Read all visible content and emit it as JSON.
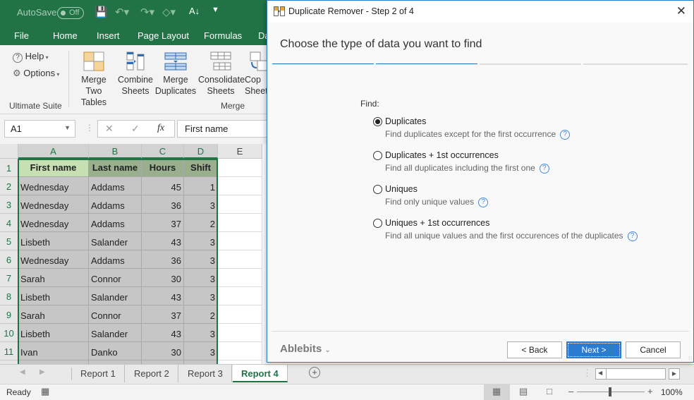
{
  "excel": {
    "titlebar": {
      "autosave_label": "AutoSave",
      "autosave_state": "Off",
      "icons": [
        "save-icon",
        "undo-icon",
        "redo-icon",
        "shape-icon",
        "sort-az-icon",
        "customize-icon"
      ]
    },
    "menu": [
      "File",
      "Home",
      "Insert",
      "Page Layout",
      "Formulas",
      "Da"
    ],
    "ribbon": {
      "help_label": "Help",
      "options_label": "Options",
      "group1_label": "Ultimate Suite",
      "buttons": [
        {
          "line1": "Merge",
          "line2": "Two Tables"
        },
        {
          "line1": "Combine",
          "line2": "Sheets"
        },
        {
          "line1": "Merge",
          "line2": "Duplicates"
        },
        {
          "line1": "Consolidate",
          "line2": "Sheets"
        },
        {
          "line1": "Cop",
          "line2": "Sheet"
        }
      ],
      "group2_label": "Merge"
    },
    "formula_bar": {
      "name_box": "A1",
      "fx_label": "fx",
      "value": "First name"
    },
    "columns": [
      "A",
      "B",
      "C",
      "D",
      "E"
    ],
    "rows": [
      "1",
      "2",
      "3",
      "4",
      "5",
      "6",
      "7",
      "8",
      "9",
      "10",
      "11"
    ],
    "table": {
      "headers": [
        "First name",
        "Last name",
        "Hours",
        "Shift"
      ],
      "rows": [
        [
          "Wednesday",
          "Addams",
          "45",
          "1"
        ],
        [
          "Wednesday",
          "Addams",
          "36",
          "3"
        ],
        [
          "Wednesday",
          "Addams",
          "37",
          "2"
        ],
        [
          "Lisbeth",
          "Salander",
          "43",
          "3"
        ],
        [
          "Wednesday",
          "Addams",
          "36",
          "3"
        ],
        [
          "Sarah",
          "Connor",
          "30",
          "3"
        ],
        [
          "Lisbeth",
          "Salander",
          "43",
          "3"
        ],
        [
          "Sarah",
          "Connor",
          "37",
          "2"
        ],
        [
          "Lisbeth",
          "Salander",
          "43",
          "3"
        ],
        [
          "Ivan",
          "Danko",
          "30",
          "3"
        ]
      ]
    },
    "sheets": [
      "Report 1",
      "Report 2",
      "Report 3",
      "Report 4"
    ],
    "active_sheet": "Report 4",
    "status": {
      "ready": "Ready",
      "zoom": "100%"
    }
  },
  "dialog": {
    "title": "Duplicate Remover - Step 2 of 4",
    "heading": "Choose the type of data you want to find",
    "step_current": 2,
    "step_total": 4,
    "find_label": "Find:",
    "options": [
      {
        "label": "Duplicates",
        "desc": "Find duplicates except for the first occurrence",
        "selected": true
      },
      {
        "label": "Duplicates + 1st occurrences",
        "desc": "Find all duplicates including the first one",
        "selected": false
      },
      {
        "label": "Uniques",
        "desc": "Find only unique values",
        "selected": false
      },
      {
        "label": "Uniques + 1st occurrences",
        "desc": "Find all unique values and the first occurences of the duplicates",
        "selected": false
      }
    ],
    "brand": "Ablebits",
    "back_label": "< Back",
    "next_label": "Next >",
    "cancel_label": "Cancel",
    "accent_color": "#2b7bd1"
  }
}
